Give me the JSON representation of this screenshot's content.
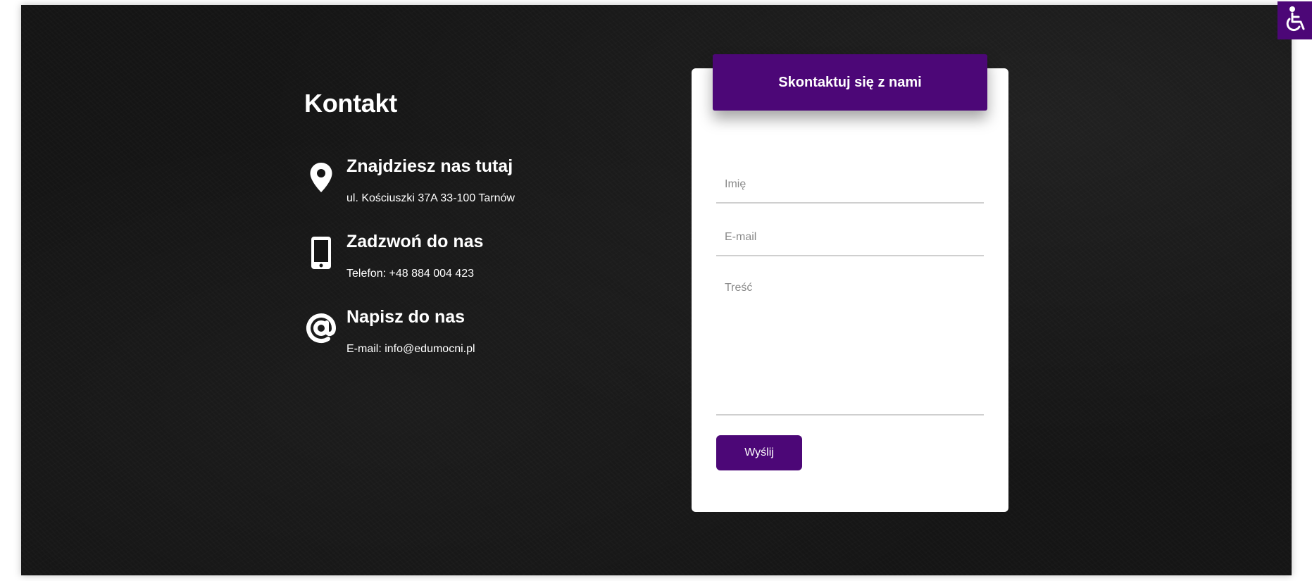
{
  "contact": {
    "title": "Kontakt",
    "address": {
      "heading": "Znajdziesz nas tutaj",
      "detail": "ul. Kościuszki 37A 33-100 Tarnów",
      "icon": "map-pin-icon"
    },
    "phone": {
      "heading": "Zadzwoń do nas",
      "detail": "Telefon: +48 884 004 423",
      "icon": "smartphone-icon"
    },
    "email": {
      "heading": "Napisz do nas",
      "detail": "E-mail: info@edumocni.pl",
      "icon": "at-sign-icon"
    }
  },
  "form": {
    "header": "Skontaktuj się z nami",
    "name_placeholder": "Imię",
    "email_placeholder": "E-mail",
    "message_placeholder": "Treść",
    "name_value": "",
    "email_value": "",
    "message_value": "",
    "submit_label": "Wyślij"
  },
  "accessibility": {
    "icon": "wheelchair-icon"
  },
  "colors": {
    "accent": "#4c0777",
    "background": "#151515",
    "card": "#ffffff",
    "text_light": "#ffffff",
    "field_border": "#cfcfcf"
  }
}
